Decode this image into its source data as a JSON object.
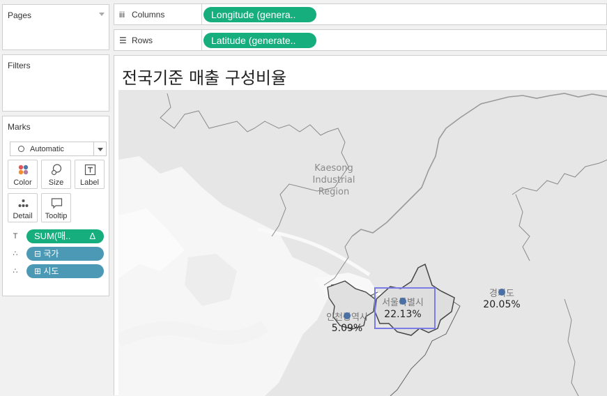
{
  "left_panel": {
    "pages_title": "Pages",
    "filters_title": "Filters",
    "marks_title": "Marks",
    "mark_type": "Automatic",
    "buttons": {
      "color": "Color",
      "size": "Size",
      "label": "Label",
      "detail": "Detail",
      "tooltip": "Tooltip"
    },
    "fields": [
      {
        "text": "SUM(매..",
        "delta": "Δ",
        "icon": "label-icon"
      },
      {
        "text": "⊟ 국가",
        "icon": "detail-icon"
      },
      {
        "text": "⊞ 시도",
        "icon": "detail-icon"
      }
    ]
  },
  "shelves": {
    "columns_label": "Columns",
    "columns_pill": "Longitude (genera..",
    "rows_label": "Rows",
    "rows_pill": "Latitude (generate.."
  },
  "view": {
    "title": "전국기준 매출 구성비율",
    "map_labels": {
      "kaesong_1": "Kaesong",
      "kaesong_2": "Industrial",
      "kaesong_3": "Region"
    },
    "marks": [
      {
        "name": "서울특별시",
        "value": "22.13%"
      },
      {
        "name": "경기도",
        "value": "20.05%"
      },
      {
        "name": "인천광역시",
        "value": "5.09%"
      }
    ]
  },
  "colors": {
    "green_pill": "#15ae7c",
    "blue_pill": "#4b99b4",
    "mark_dot": "#4a6fa5",
    "selection": "#7b7be8"
  }
}
